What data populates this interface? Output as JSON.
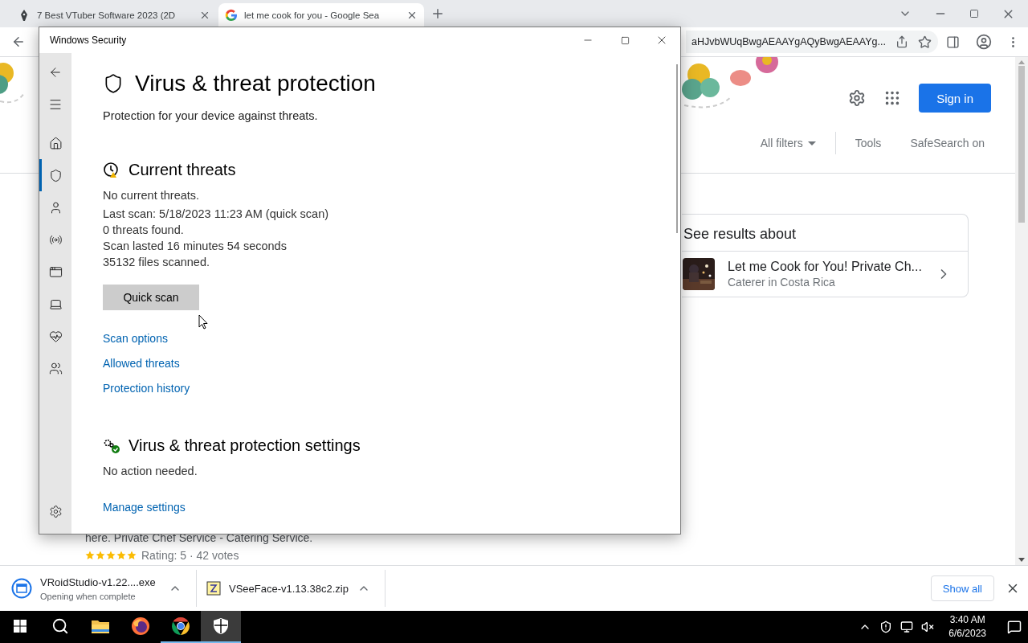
{
  "browser": {
    "tabs": [
      {
        "title": "7 Best VTuber Software 2023 (2D",
        "kind": "page",
        "selected": false
      },
      {
        "title": "let me cook for you - Google Sea",
        "kind": "google",
        "selected": true
      }
    ],
    "address": "aHJvbWUqBwgAEAAYgAQyBwgAEAAYg..."
  },
  "google": {
    "sign_in": "Sign in",
    "filters": [
      {
        "label": "All filters",
        "kind": "dropdown"
      },
      {
        "label": "Tools",
        "kind": "plain"
      },
      {
        "label": "SafeSearch on",
        "kind": "plain"
      }
    ],
    "card": {
      "heading": "See results about",
      "title": "Let me Cook for You! Private Ch...",
      "subtitle": "Caterer in Costa Rica"
    },
    "snippet": "here. Private Chef Service - Catering Service.",
    "rating": {
      "stars": 5,
      "text": "Rating: 5 · 42 votes"
    }
  },
  "downloads": {
    "items": [
      {
        "kind": "exe",
        "name": "VRoidStudio-v1.22....exe",
        "status": "Opening when complete"
      },
      {
        "kind": "zip",
        "name": "VSeeFace-v1.13.38c2.zip"
      }
    ],
    "show_all": "Show all"
  },
  "taskbar": {
    "apps": [
      {
        "kind": "explorer",
        "open": false,
        "selected": false
      },
      {
        "kind": "firefox",
        "open": false,
        "selected": false
      },
      {
        "kind": "chrome",
        "open": true,
        "selected": false
      },
      {
        "kind": "security",
        "open": true,
        "selected": true
      }
    ],
    "time": "3:40 AM",
    "date": "6/6/2023"
  },
  "window": {
    "title": "Windows Security",
    "nav": [
      {
        "kind": "home",
        "selected": false
      },
      {
        "kind": "shield",
        "selected": true
      },
      {
        "kind": "account",
        "selected": false
      },
      {
        "kind": "network",
        "selected": false
      },
      {
        "kind": "app",
        "selected": false
      },
      {
        "kind": "device",
        "selected": false
      },
      {
        "kind": "health",
        "selected": false
      },
      {
        "kind": "family",
        "selected": false
      }
    ],
    "heading": "Virus & threat protection",
    "subtitle": "Protection for your device against threats.",
    "sections": [
      {
        "kind": "threats",
        "title": "Current threats",
        "lines": [
          "No current threats.",
          "Last scan: 5/18/2023 11:23 AM (quick scan)",
          "0 threats found.",
          "Scan lasted 16 minutes 54 seconds",
          "35132 files scanned."
        ],
        "button": "Quick scan",
        "links": [
          "Scan options",
          "Allowed threats",
          "Protection history"
        ]
      },
      {
        "kind": "settings",
        "title": "Virus & threat protection settings",
        "lines": [
          "No action needed."
        ],
        "links": [
          "Manage settings"
        ]
      }
    ]
  }
}
